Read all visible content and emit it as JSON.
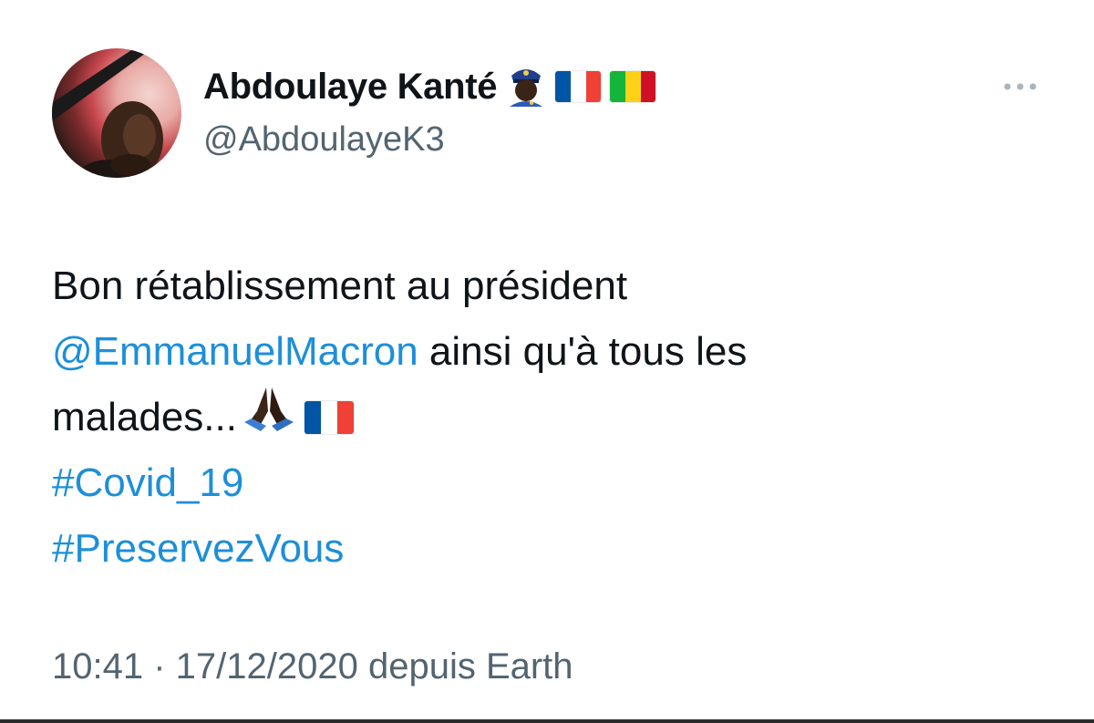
{
  "author": {
    "display_name": "Abdoulaye Kanté",
    "handle": "@AbdoulayeK3",
    "badges": [
      "police-officer-emoji",
      "france-flag-emoji",
      "mali-flag-emoji"
    ]
  },
  "tweet": {
    "line1": "Bon rétablissement au président",
    "mention": "@EmmanuelMacron",
    "line2_rest": " ainsi qu'à tous les",
    "line3": "malades...",
    "line3_emojis": [
      "folded-hands-emoji",
      "france-flag-emoji"
    ],
    "hashtag1": "#Covid_19",
    "hashtag2": "#PreservezVous"
  },
  "meta": {
    "timestamp": "10:41 · 17/12/2020 depuis Earth"
  },
  "colors": {
    "link": "#1d8fd8",
    "secondary_text": "#536471",
    "primary_text": "#0f1419",
    "france_blue": "#0055a4",
    "france_red": "#ef4135",
    "mali_green": "#14b53a",
    "mali_yellow": "#fcd116",
    "mali_red": "#ce1126"
  }
}
